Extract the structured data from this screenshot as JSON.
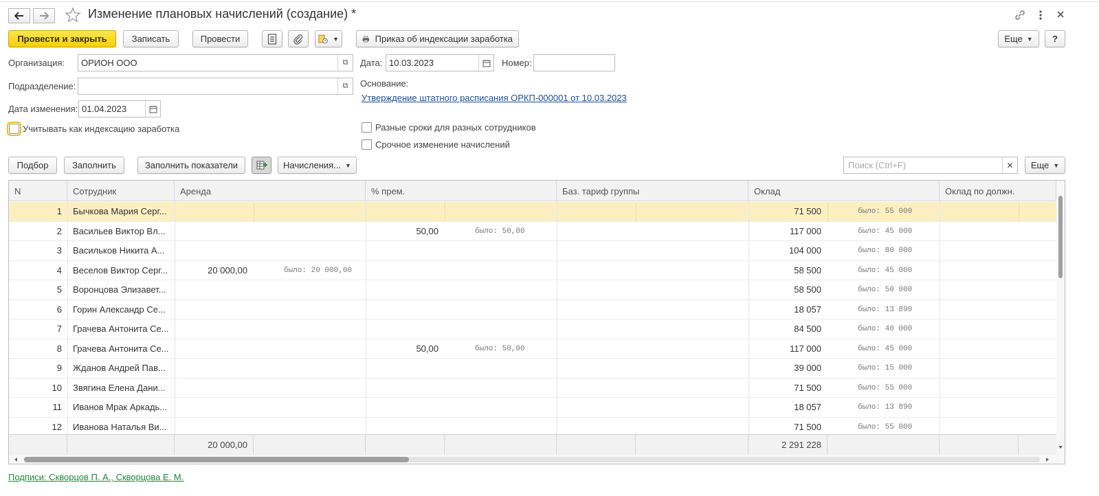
{
  "window": {
    "title": "Изменение плановых начислений (создание) *"
  },
  "toolbar": {
    "post_close": "Провести и закрыть",
    "write": "Записать",
    "post": "Провести",
    "print_order": "Приказ об индексации заработка",
    "more": "Еще",
    "help": "?"
  },
  "form": {
    "org_label": "Организация:",
    "org_value": "ОРИОН ООО",
    "dept_label": "Подразделение:",
    "dept_value": "",
    "change_date_label": "Дата изменения:",
    "change_date_value": "01.04.2023",
    "date_label": "Дата:",
    "date_value": "10.03.2023",
    "number_label": "Номер:",
    "number_value": "",
    "basis_label": "Основание:",
    "basis_link": "Утверждение штатного расписания ОРКП-000001 от 10.03.2023",
    "indexation_checkbox": "Учитывать как индексацию заработка",
    "different_dates_checkbox": "Разные сроки для разных сотрудников",
    "urgent_change_checkbox": "Срочное изменение начислений"
  },
  "table_toolbar": {
    "pick": "Подбор",
    "fill": "Заполнить",
    "fill_indicators": "Заполнить показатели",
    "accruals": "Начисления...",
    "search_placeholder": "Поиск (Ctrl+F)",
    "more": "Еще"
  },
  "table": {
    "headers": [
      "N",
      "Сотрудник",
      "Аренда",
      "% прем.",
      "Баз. тариф группы",
      "Оклад",
      "Оклад по должн."
    ],
    "rows": [
      {
        "n": "1",
        "employee": "Бычкова Мария Серг...",
        "rent": "",
        "rent_was": "",
        "bonus": "",
        "bonus_was": "",
        "salary": "71 500",
        "salary_was": "было:   55 000"
      },
      {
        "n": "2",
        "employee": "Васильев Виктор Вл...",
        "rent": "",
        "rent_was": "",
        "bonus": "50,00",
        "bonus_was": "было:     50,00",
        "salary": "117 000",
        "salary_was": "было:   45 000"
      },
      {
        "n": "3",
        "employee": "Васильков Никита А...",
        "rent": "",
        "rent_was": "",
        "bonus": "",
        "bonus_was": "",
        "salary": "104 000",
        "salary_was": "было:   80 000"
      },
      {
        "n": "4",
        "employee": "Веселов Виктор Серг...",
        "rent": "20 000,00",
        "rent_was": "было:  20 000,00",
        "bonus": "",
        "bonus_was": "",
        "salary": "58 500",
        "salary_was": "было:   45 000"
      },
      {
        "n": "5",
        "employee": "Воронцова Элизавет...",
        "rent": "",
        "rent_was": "",
        "bonus": "",
        "bonus_was": "",
        "salary": "58 500",
        "salary_was": "было:   50 000"
      },
      {
        "n": "6",
        "employee": "Горин Александр Се...",
        "rent": "",
        "rent_was": "",
        "bonus": "",
        "bonus_was": "",
        "salary": "18 057",
        "salary_was": "было:   13 890"
      },
      {
        "n": "7",
        "employee": "Грачева Антонита Се...",
        "rent": "",
        "rent_was": "",
        "bonus": "",
        "bonus_was": "",
        "salary": "84 500",
        "salary_was": "было:   40 000"
      },
      {
        "n": "8",
        "employee": "Грачева Антонита Се...",
        "rent": "",
        "rent_was": "",
        "bonus": "50,00",
        "bonus_was": "было:     50,00",
        "salary": "117 000",
        "salary_was": "было:   45 000"
      },
      {
        "n": "9",
        "employee": "Жданов Андрей Пав...",
        "rent": "",
        "rent_was": "",
        "bonus": "",
        "bonus_was": "",
        "salary": "39 000",
        "salary_was": "было:   15 000"
      },
      {
        "n": "10",
        "employee": "Звягина Елена Дани...",
        "rent": "",
        "rent_was": "",
        "bonus": "",
        "bonus_was": "",
        "salary": "71 500",
        "salary_was": "было:   55 000"
      },
      {
        "n": "11",
        "employee": "Иванов Мрак Аркадь...",
        "rent": "",
        "rent_was": "",
        "bonus": "",
        "bonus_was": "",
        "salary": "18 057",
        "salary_was": "было:   13 890"
      },
      {
        "n": "12",
        "employee": "Иванова Наталья Ви...",
        "rent": "",
        "rent_was": "",
        "bonus": "",
        "bonus_was": "",
        "salary": "71 500",
        "salary_was": "было:   55 000"
      }
    ],
    "totals": {
      "rent": "20 000,00",
      "salary": "2 291 228"
    }
  },
  "footer": {
    "signatures": "Подписи: Скворцов П. А., Скворцова Е. М."
  },
  "colors": {
    "primary_button": "#f5d10f",
    "selected_row": "#fbefc2",
    "link": "#1a4e9c",
    "signatures_link": "#1a8a3a"
  }
}
